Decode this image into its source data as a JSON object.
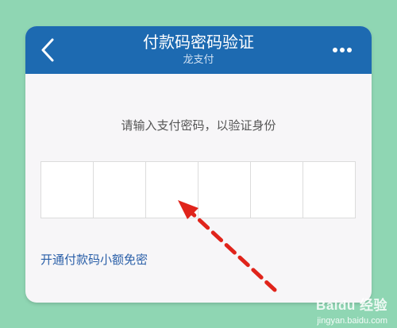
{
  "header": {
    "title": "付款码密码验证",
    "subtitle": "龙支付",
    "back_icon": "chevron-left-icon",
    "more_icon": "more-horizontal-icon"
  },
  "main": {
    "instruction": "请输入支付密码，以验证身份",
    "pin_length": 6,
    "link_text": "开通付款码小额免密"
  },
  "watermark": {
    "logo": "Baidu 经验",
    "url": "jingyan.baidu.com"
  },
  "colors": {
    "background": "#8fd6b3",
    "header": "#1d6ab1",
    "link": "#2a5fa8",
    "arrow": "#e0241b"
  }
}
